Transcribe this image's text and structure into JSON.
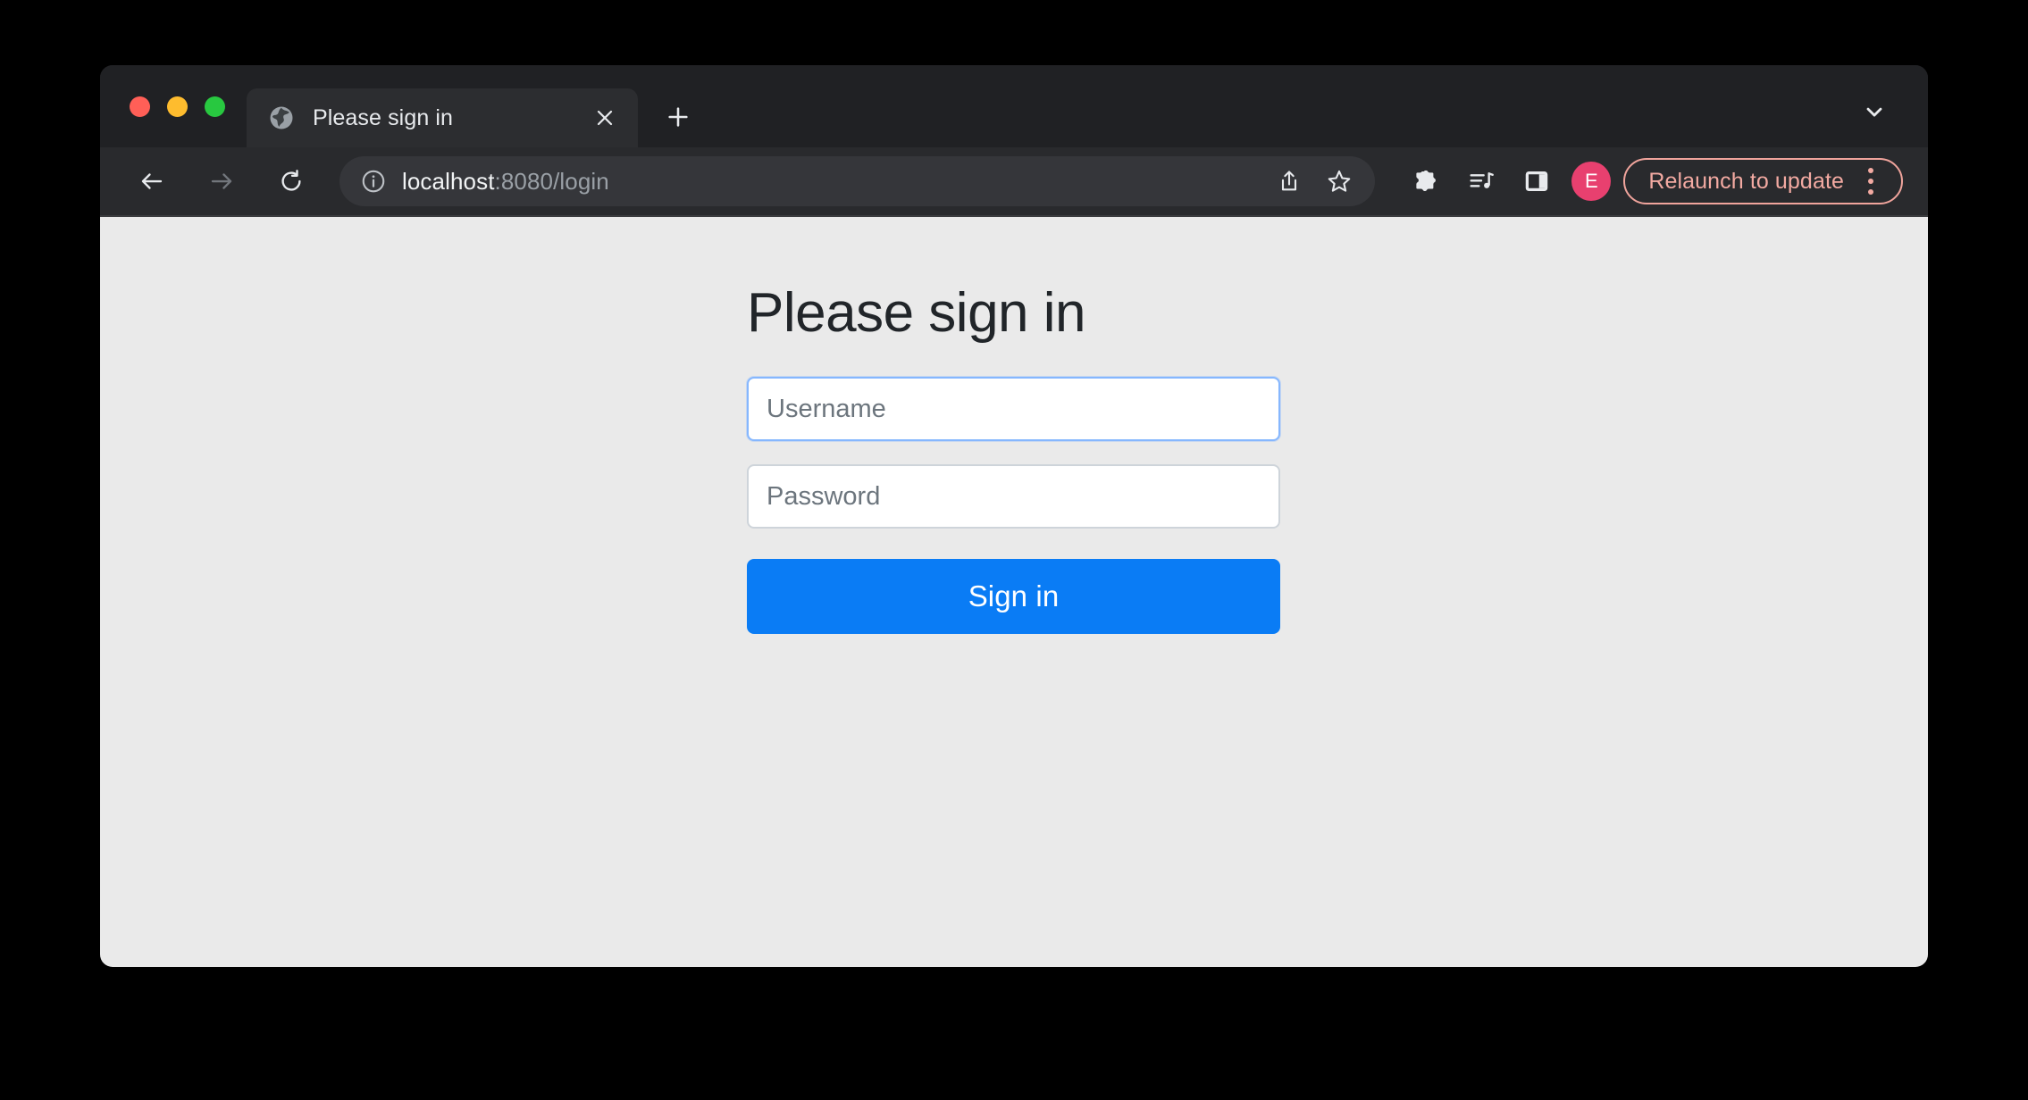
{
  "window": {
    "traffic_lights": [
      {
        "name": "close",
        "color": "#ff5f57"
      },
      {
        "name": "minimize",
        "color": "#febc2e"
      },
      {
        "name": "zoom",
        "color": "#28c840"
      }
    ]
  },
  "tab_strip": {
    "tabs": [
      {
        "title": "Please sign in",
        "favicon": "globe-icon",
        "active": true
      }
    ],
    "close_tab_label": "×",
    "new_tab_label": "+",
    "tab_search_icon": "chevron-down-icon"
  },
  "toolbar": {
    "back_icon": "back-arrow-icon",
    "forward_icon": "forward-arrow-icon",
    "reload_icon": "reload-icon",
    "site_info_icon": "info-circle-icon",
    "url": {
      "host": "localhost",
      "rest": ":8080/login",
      "full": "localhost:8080/login"
    },
    "share_icon": "share-icon",
    "bookmark_icon": "star-icon",
    "extensions_icon": "puzzle-piece-icon",
    "media_icon": "media-control-icon",
    "side_panel_icon": "side-panel-icon",
    "profile": {
      "initial": "E",
      "color": "#e8406f"
    },
    "relaunch": {
      "label": "Relaunch to update",
      "accent_color": "#f3aaa2",
      "menu_icon": "three-dot-menu-icon"
    }
  },
  "page": {
    "background_color": "#eaeaea",
    "heading": "Please sign in",
    "username": {
      "placeholder": "Username",
      "value": "",
      "focused": true
    },
    "password": {
      "placeholder": "Password",
      "value": "",
      "focused": false
    },
    "submit": {
      "label": "Sign in",
      "color": "#0a7cf5"
    }
  }
}
